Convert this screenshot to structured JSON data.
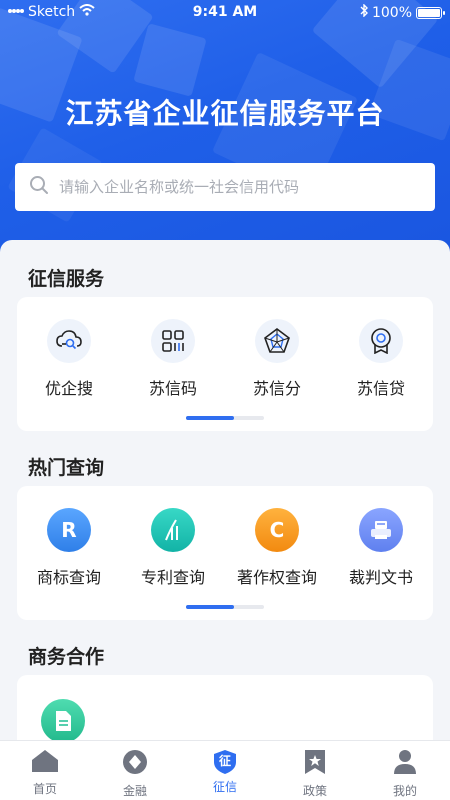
{
  "status_bar": {
    "carrier": "Sketch",
    "time": "9:41 AM",
    "battery": "100%"
  },
  "header": {
    "title": "江苏省企业征信服务平台"
  },
  "search": {
    "placeholder": "请输入企业名称或统一社会信用代码",
    "value": ""
  },
  "sections": {
    "credit_services": {
      "title": "征信服务",
      "items": [
        {
          "label": "优企搜",
          "icon": "cloud-search-icon"
        },
        {
          "label": "苏信码",
          "icon": "qr-code-icon"
        },
        {
          "label": "苏信分",
          "icon": "radar-score-icon"
        },
        {
          "label": "苏信贷",
          "icon": "medal-loan-icon"
        }
      ],
      "page_indicator": {
        "page": 1,
        "pages": 2
      }
    },
    "hot_queries": {
      "title": "热门查询",
      "items": [
        {
          "label": "商标查询",
          "icon": "trademark-icon",
          "color": "#3e8ff2"
        },
        {
          "label": "专利查询",
          "icon": "patent-icon",
          "color": "#1fc3b5"
        },
        {
          "label": "著作权查询",
          "icon": "copyright-icon",
          "color": "#f59a1b"
        },
        {
          "label": "裁判文书",
          "icon": "judgment-printer-icon",
          "color": "#6b8cf5"
        }
      ],
      "page_indicator": {
        "page": 1,
        "pages": 2
      }
    },
    "business_cooperation": {
      "title": "商务合作",
      "items": [
        {
          "icon": "document-icon",
          "color": "#2cc39a"
        }
      ]
    }
  },
  "tabbar": {
    "active": "征信",
    "items": [
      {
        "label": "首页",
        "icon": "home-icon"
      },
      {
        "label": "金融",
        "icon": "finance-icon"
      },
      {
        "label": "征信",
        "icon": "credit-shield-icon",
        "badge": "征"
      },
      {
        "label": "政策",
        "icon": "policy-bookmark-icon"
      },
      {
        "label": "我的",
        "icon": "profile-icon"
      }
    ]
  },
  "colors": {
    "brand": "#2f6ef0",
    "background": "#f3f5f9",
    "tab_inactive": "#6f7480"
  }
}
